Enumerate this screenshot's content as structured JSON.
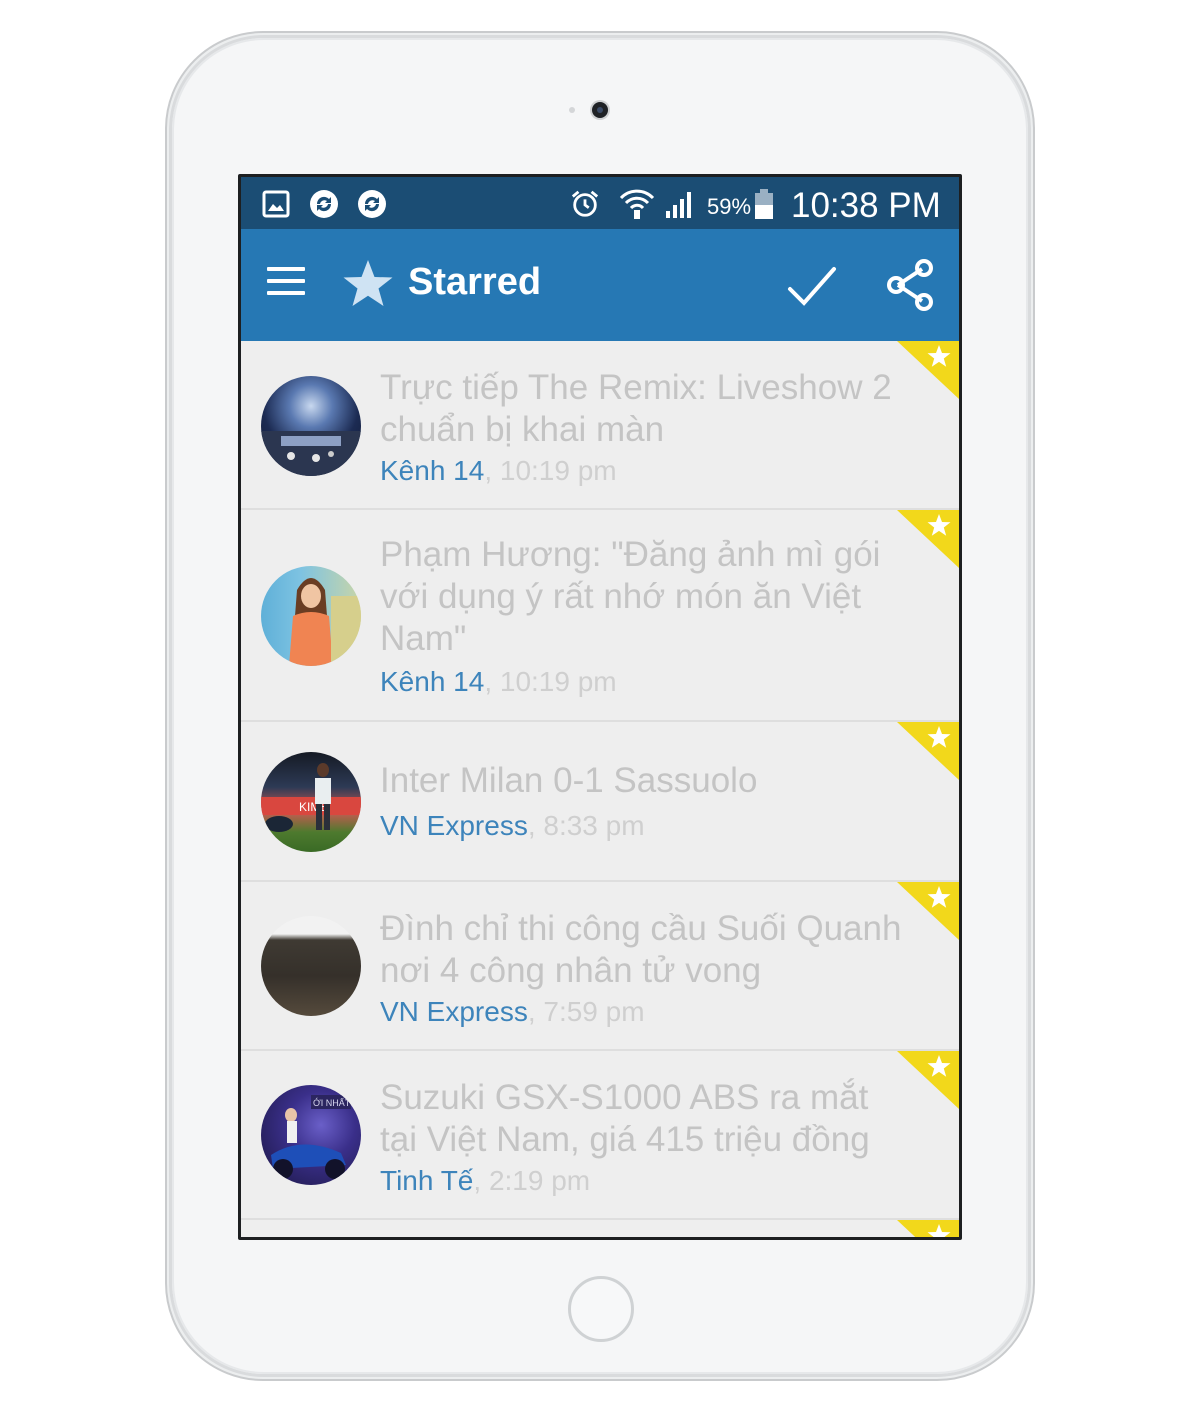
{
  "status_bar": {
    "battery_percent": "59%",
    "time": "10:38 PM",
    "icons": [
      "gallery-icon",
      "sync-icon",
      "sync-icon",
      "alarm-icon",
      "wifi-icon",
      "signal-icon",
      "battery-icon"
    ]
  },
  "toolbar": {
    "title": "Starred",
    "icons": [
      "menu-icon",
      "star-icon",
      "check-icon",
      "share-icon"
    ]
  },
  "colors": {
    "status_bar": "#1b4d74",
    "toolbar": "#2678b4",
    "source": "#3d84bb",
    "corner_badge": "#f2d81b"
  },
  "articles": [
    {
      "title": "Trực tiếp The Remix: Liveshow 2 chuẩn bị khai màn",
      "source": "Kênh 14",
      "time": ", 10:19 pm",
      "starred": true
    },
    {
      "title": "Phạm Hương: \"Đăng ảnh mì gói với dụng ý rất nhớ món ăn Việt Nam\"",
      "source": "Kênh 14",
      "time": ", 10:19 pm",
      "starred": true
    },
    {
      "title": "Inter Milan 0-1 Sassuolo",
      "source": "VN Express",
      "time": ", 8:33 pm",
      "starred": true
    },
    {
      "title": "Đình chỉ thi công cầu Suối Quanh nơi 4 công nhân tử vong",
      "source": "VN Express",
      "time": ", 7:59 pm",
      "starred": true
    },
    {
      "title": "Suzuki GSX-S1000 ABS ra mắt tại Việt Nam, giá 415 triệu đồng",
      "source": "Tinh Tế",
      "time": ", 2:19 pm",
      "starred": true
    }
  ]
}
